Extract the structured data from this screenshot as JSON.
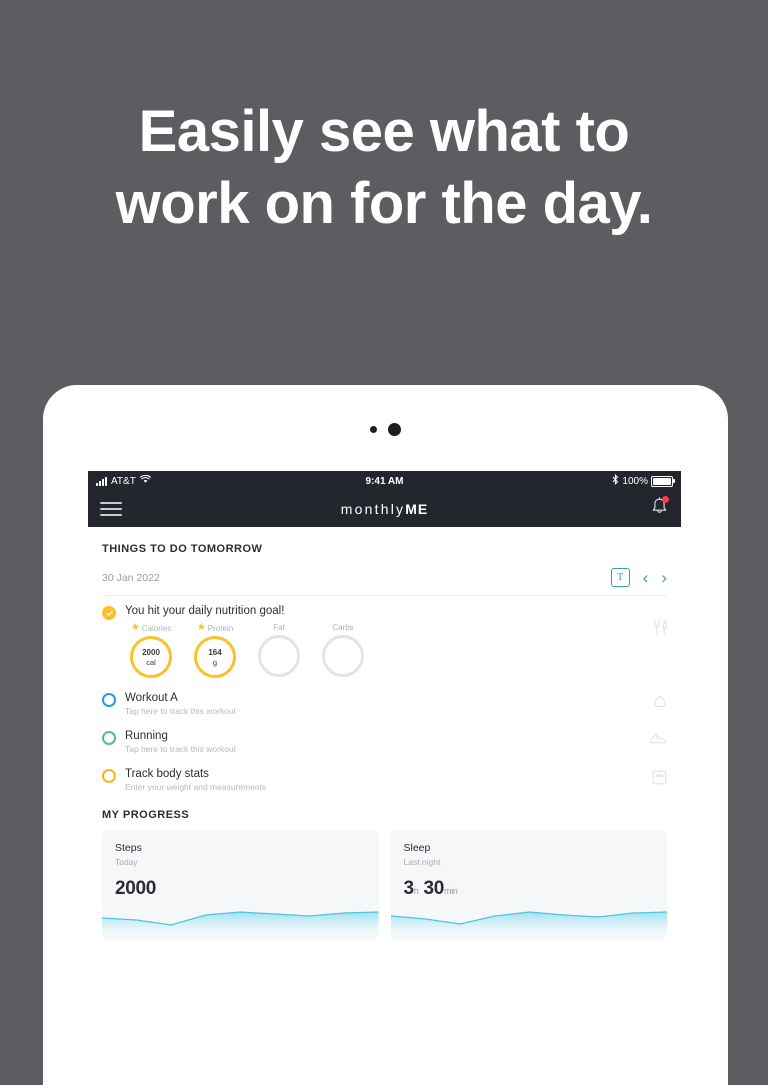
{
  "marketing": {
    "headline_line1": "Easily see what to",
    "headline_line2": "work on for the day."
  },
  "device": {
    "camera_icon": "camera-dot",
    "sensor_icon": "sensor-dot"
  },
  "statusbar": {
    "carrier": "AT&T",
    "signal_icon": "signal-bars-icon",
    "wifi_icon": "wifi-icon",
    "time": "9:41 AM",
    "bluetooth_icon": "bluetooth-icon",
    "battery_percent": "100%",
    "battery_icon": "battery-full-icon"
  },
  "appbar": {
    "menu_icon": "hamburger-menu-icon",
    "brand_light": "monthly",
    "brand_bold": "ME",
    "bell_icon": "notification-bell-icon",
    "bell_badge": true
  },
  "header": {
    "section_title": "THINGS TO DO TOMORROW",
    "date": "30 Jan 2022",
    "today_button": "T",
    "prev_icon": "chevron-left-icon",
    "next_icon": "chevron-right-icon",
    "accent_color": "#2e9fb5"
  },
  "nutrition": {
    "title": "You hit your daily nutrition goal!",
    "status_icon": "check-circle-filled-icon",
    "food_icon": "cutlery-icon",
    "rings": [
      {
        "label": "Calories",
        "starred": true,
        "value": "2000",
        "unit": "cal",
        "complete": true
      },
      {
        "label": "Protein",
        "starred": true,
        "value": "164",
        "unit": "g",
        "complete": true
      },
      {
        "label": "Fat",
        "starred": false,
        "value": "",
        "unit": "",
        "complete": false
      },
      {
        "label": "Carbs",
        "starred": false,
        "value": "",
        "unit": "",
        "complete": false
      }
    ]
  },
  "tasks": [
    {
      "title": "Workout A",
      "subtitle": "Tap here to track this workout",
      "checkbox_color": "#1f9fe0",
      "icon": "kettlebell-icon"
    },
    {
      "title": "Running",
      "subtitle": "Tap here to track this workout",
      "checkbox_color": "#4fc17a",
      "icon": "running-shoe-icon"
    },
    {
      "title": "Track body stats",
      "subtitle": "Enter your weight and measurements",
      "checkbox_color": "#f3b719",
      "icon": "scale-icon"
    }
  ],
  "progress": {
    "title": "MY PROGRESS",
    "cards": [
      {
        "title": "Steps",
        "subtitle": "Today",
        "value": "2000",
        "unit": "",
        "value2": "",
        "unit2": ""
      },
      {
        "title": "Sleep",
        "subtitle": "Last night",
        "value": "3",
        "unit": "h",
        "value2": "30",
        "unit2": "min"
      }
    ]
  },
  "chart_data": [
    {
      "type": "area",
      "title": "Steps",
      "x": [
        0,
        1,
        2,
        3,
        4,
        5,
        6,
        7
      ],
      "values": [
        20,
        17,
        12,
        22,
        27,
        24,
        22,
        26,
        27
      ],
      "line_color": "#4ec3e0",
      "fill_color": "#bfe9f4",
      "grid": false,
      "xlabel": "",
      "ylabel": ""
    },
    {
      "type": "area",
      "title": "Sleep",
      "x": [
        0,
        1,
        2,
        3,
        4,
        5,
        6,
        7
      ],
      "values": [
        22,
        20,
        14,
        21,
        26,
        22,
        21,
        25,
        26
      ],
      "line_color": "#4ec3e0",
      "fill_color": "#bfe9f4",
      "grid": false,
      "xlabel": "",
      "ylabel": ""
    }
  ],
  "theme": {
    "background": "#5c5d61",
    "statusbar_bg": "#24262d",
    "accent_yellow": "#fcc02b",
    "accent_teal": "#2e9fb5",
    "accent_blue": "#1f9fe0",
    "accent_green": "#4fc17a"
  }
}
